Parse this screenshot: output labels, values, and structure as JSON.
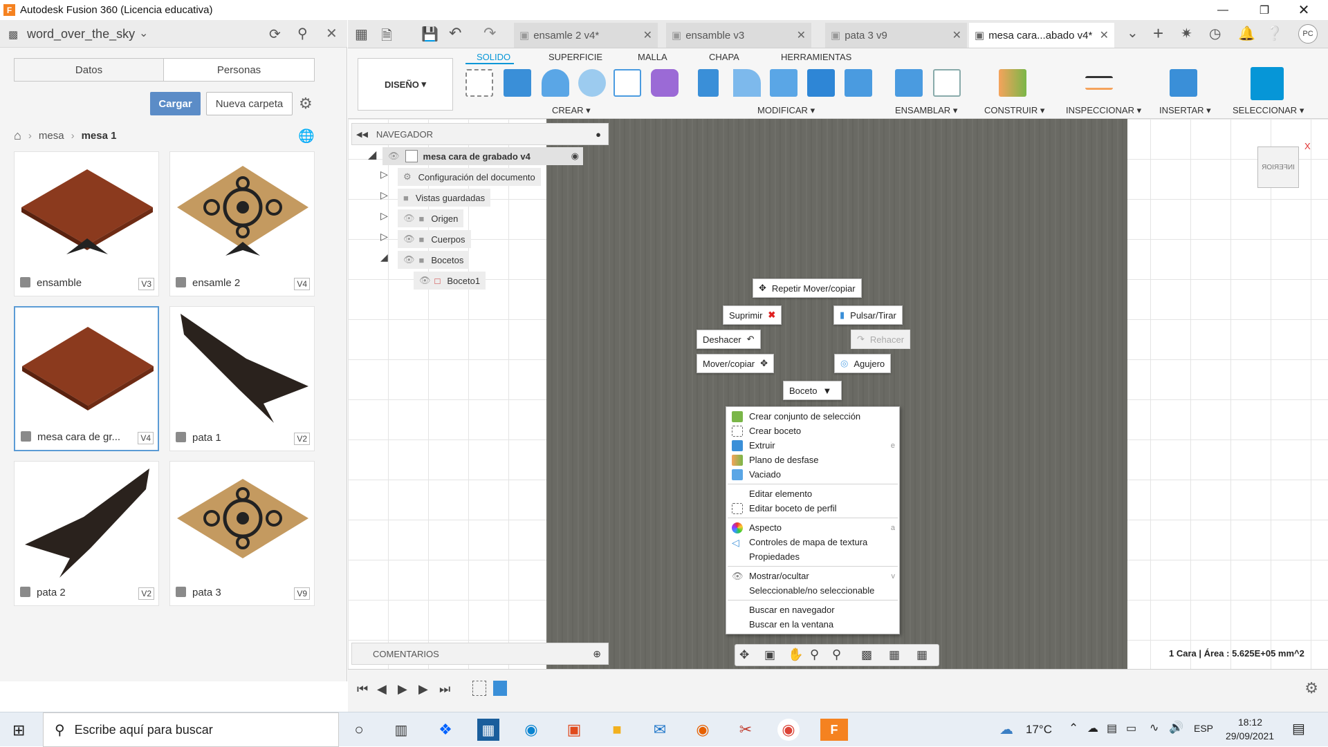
{
  "window": {
    "title": "Autodesk Fusion 360 (Licencia educativa)"
  },
  "data_panel": {
    "project": "word_over_the_sky",
    "tabs": [
      "Datos",
      "Personas"
    ],
    "upload_label": "Cargar",
    "new_folder_label": "Nueva carpeta",
    "breadcrumb": [
      "mesa",
      "mesa 1"
    ],
    "files": [
      {
        "name": "ensamble",
        "version": "V3"
      },
      {
        "name": "ensamle 2",
        "version": "V4"
      },
      {
        "name": "mesa cara de gr...",
        "version": "V4"
      },
      {
        "name": "pata 1",
        "version": "V2"
      },
      {
        "name": "pata 2",
        "version": "V2"
      },
      {
        "name": "pata 3",
        "version": "V9"
      }
    ]
  },
  "doc_tabs": [
    {
      "label": "ensamle 2 v4*"
    },
    {
      "label": "ensamble v3"
    },
    {
      "label": "pata 3 v9"
    },
    {
      "label": "mesa cara...abado v4*"
    }
  ],
  "user_initials": "PC",
  "toolbar": {
    "workspace": "DISEÑO",
    "tabs": [
      "SOLIDO",
      "SUPERFICIE",
      "MALLA",
      "CHAPA",
      "HERRAMIENTAS"
    ],
    "groups": [
      "CREAR",
      "MODIFICAR",
      "ENSAMBLAR",
      "CONSTRUIR",
      "INSPECCIONAR",
      "INSERTAR",
      "SELECCIONAR"
    ]
  },
  "browser": {
    "title": "NAVEGADOR",
    "root": "mesa cara de grabado v4",
    "items": [
      "Configuración del documento",
      "Vistas guardadas",
      "Origen",
      "Cuerpos",
      "Bocetos",
      "Boceto1"
    ],
    "comments": "COMENTARIOS"
  },
  "view_cube": {
    "face": "INFERIOR",
    "axis": "X"
  },
  "marking_menu": {
    "repeat": "Repetir Mover/copiar",
    "delete": "Suprimir",
    "press_pull": "Pulsar/Tirar",
    "undo": "Deshacer",
    "redo": "Rehacer",
    "move": "Mover/copiar",
    "hole": "Agujero",
    "sketch": "Boceto"
  },
  "context_menu": [
    {
      "label": "Crear conjunto de selección",
      "shortcut": ""
    },
    {
      "label": "Crear boceto",
      "shortcut": ""
    },
    {
      "label": "Extruir",
      "shortcut": "e"
    },
    {
      "label": "Plano de desfase",
      "shortcut": ""
    },
    {
      "label": "Vaciado",
      "shortcut": ""
    },
    {
      "label": "Editar elemento",
      "shortcut": ""
    },
    {
      "label": "Editar boceto de perfil",
      "shortcut": ""
    },
    {
      "label": "Aspecto",
      "shortcut": "a"
    },
    {
      "label": "Controles de mapa de textura",
      "shortcut": ""
    },
    {
      "label": "Propiedades",
      "shortcut": ""
    },
    {
      "label": "Mostrar/ocultar",
      "shortcut": "v"
    },
    {
      "label": "Seleccionable/no seleccionable",
      "shortcut": ""
    },
    {
      "label": "Buscar en navegador",
      "shortcut": ""
    },
    {
      "label": "Buscar en la ventana",
      "shortcut": ""
    }
  ],
  "status": "1 Cara | Área : 5.625E+05 mm^2",
  "taskbar": {
    "search_placeholder": "Escribe aquí para buscar",
    "weather": "17°C",
    "language": "ESP",
    "time": "18:12",
    "date": "29/09/2021"
  },
  "colors": {
    "accent": "#0696d7",
    "upload_button": "#5b8cc7",
    "wood": "#8b3a1e",
    "engraved": "#c49a60"
  }
}
